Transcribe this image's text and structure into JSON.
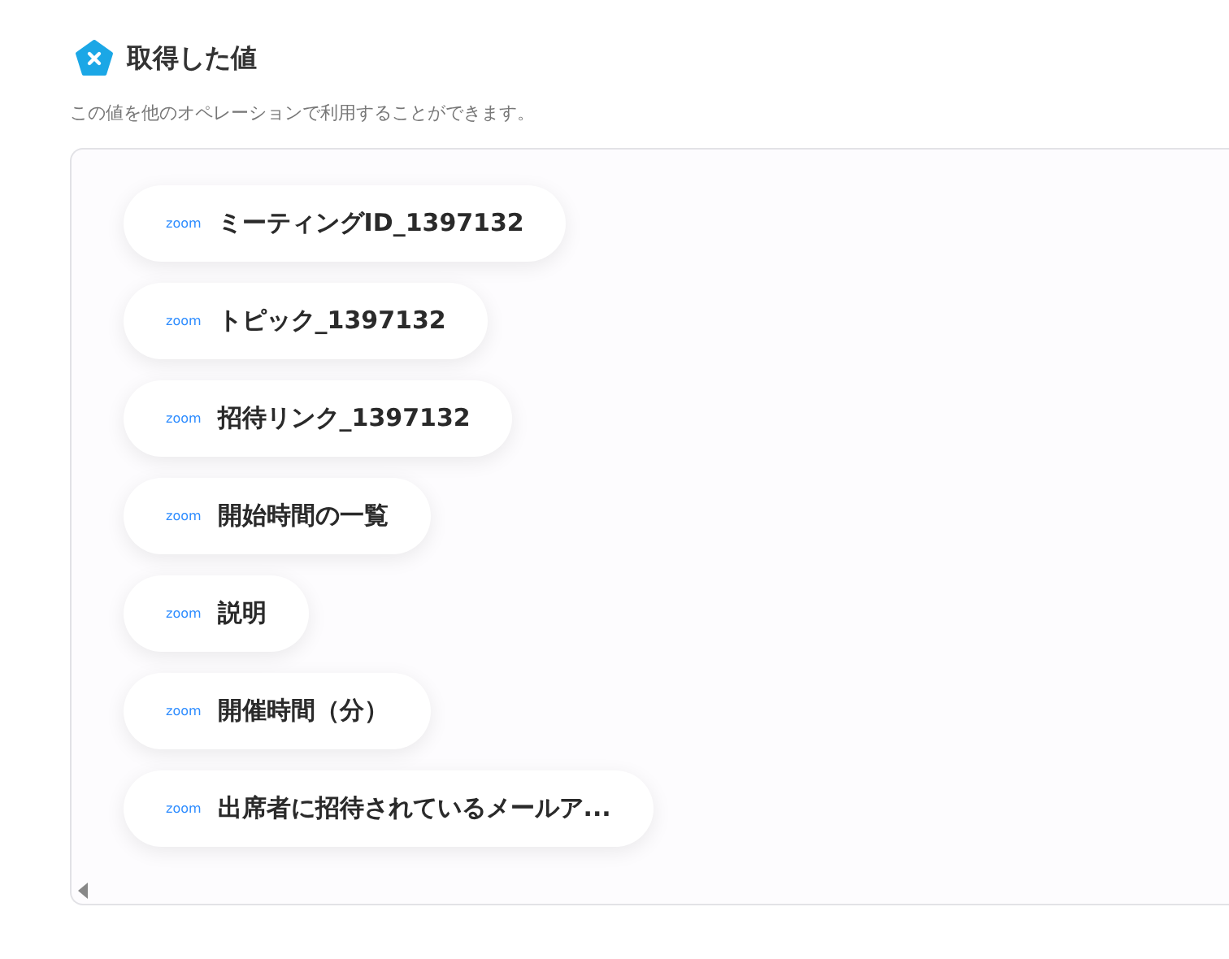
{
  "header": {
    "title": "取得した値",
    "description": "この値を他のオペレーションで利用することができます。"
  },
  "values": [
    {
      "source": "zoom",
      "label": "ミーティングID_1397132"
    },
    {
      "source": "zoom",
      "label": "トピック_1397132"
    },
    {
      "source": "zoom",
      "label": "招待リンク_1397132"
    },
    {
      "source": "zoom",
      "label": "開始時間の一覧"
    },
    {
      "source": "zoom",
      "label": "説明"
    },
    {
      "source": "zoom",
      "label": "開催時間（分）"
    },
    {
      "source": "zoom",
      "label": "出席者に招待されているメールア..."
    }
  ]
}
